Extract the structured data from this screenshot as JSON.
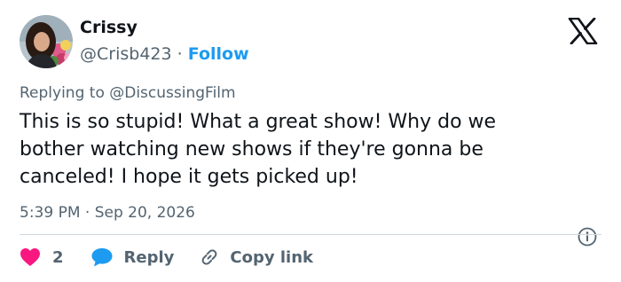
{
  "author": {
    "display_name": "Crissy",
    "handle": "@Crisb423",
    "separator": "·",
    "follow_label": "Follow"
  },
  "reply_context": {
    "text": "Replying to @DiscussingFilm"
  },
  "tweet": {
    "lines": [
      "This is so stupid! What a great show! Why do we",
      "bother watching new shows if they're gonna be",
      "canceled! I hope it gets picked up!"
    ],
    "timestamp": "5:39 PM · Sep 20, 2026"
  },
  "actions": {
    "like_count": "2",
    "reply_label": "Reply",
    "copy_link_label": "Copy link"
  },
  "icons": {
    "brand": "x-logo-icon",
    "info": "info-icon",
    "like": "heart-icon",
    "reply": "speech-bubble-icon",
    "copy": "link-icon"
  },
  "colors": {
    "text": "#0f1419",
    "secondary": "#536471",
    "accent_blue": "#1d9bf0",
    "like_pink": "#f91880",
    "divider": "#cfd9de"
  }
}
